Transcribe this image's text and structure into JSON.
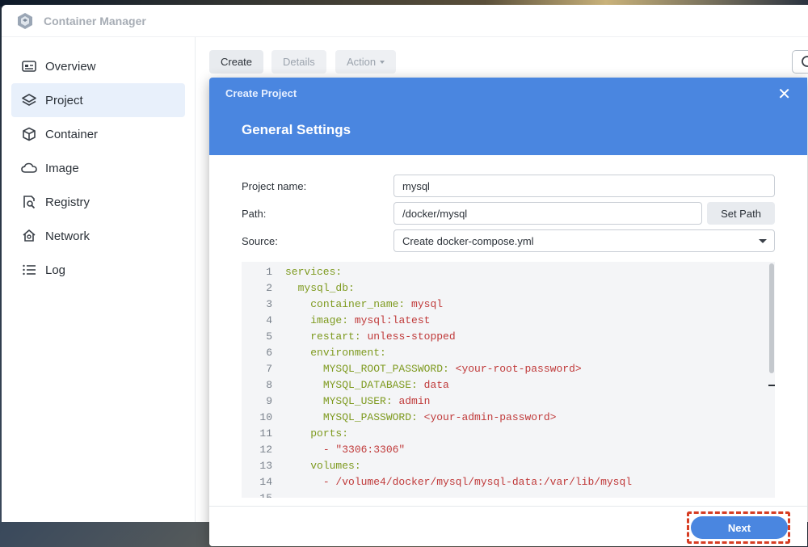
{
  "app": {
    "title": "Container Manager"
  },
  "sidebar": {
    "items": [
      {
        "label": "Overview",
        "icon": "overview-icon"
      },
      {
        "label": "Project",
        "icon": "layers-icon",
        "active": true
      },
      {
        "label": "Container",
        "icon": "cube-icon"
      },
      {
        "label": "Image",
        "icon": "cloud-icon"
      },
      {
        "label": "Registry",
        "icon": "registry-search-icon"
      },
      {
        "label": "Network",
        "icon": "network-house-icon"
      },
      {
        "label": "Log",
        "icon": "list-icon"
      }
    ]
  },
  "toolbar": {
    "create_label": "Create",
    "details_label": "Details",
    "action_label": "Action"
  },
  "modal": {
    "title": "Create Project",
    "heading": "General Settings",
    "close_glyph": "✕",
    "fields": {
      "project_name_label": "Project name:",
      "project_name_value": "mysql",
      "path_label": "Path:",
      "path_value": "/docker/mysql",
      "set_path_label": "Set Path",
      "source_label": "Source:",
      "source_value": "Create docker-compose.yml"
    },
    "code": [
      {
        "n": "1",
        "indent": "",
        "key": "services:",
        "val": ""
      },
      {
        "n": "2",
        "indent": "  ",
        "key": "mysql_db:",
        "val": ""
      },
      {
        "n": "3",
        "indent": "    ",
        "key": "container_name:",
        "val": " mysql"
      },
      {
        "n": "4",
        "indent": "    ",
        "key": "image:",
        "val": " mysql:latest"
      },
      {
        "n": "5",
        "indent": "    ",
        "key": "restart:",
        "val": " unless-stopped"
      },
      {
        "n": "6",
        "indent": "    ",
        "key": "environment:",
        "val": ""
      },
      {
        "n": "7",
        "indent": "      ",
        "key": "MYSQL_ROOT_PASSWORD:",
        "val": " <your-root-password>"
      },
      {
        "n": "8",
        "indent": "      ",
        "key": "MYSQL_DATABASE:",
        "val": " data"
      },
      {
        "n": "9",
        "indent": "      ",
        "key": "MYSQL_USER:",
        "val": " admin"
      },
      {
        "n": "10",
        "indent": "      ",
        "key": "MYSQL_PASSWORD:",
        "val": " <your-admin-password>"
      },
      {
        "n": "11",
        "indent": "    ",
        "key": "ports:",
        "val": ""
      },
      {
        "n": "12",
        "indent": "      ",
        "key": "- ",
        "val": "\"3306:3306\""
      },
      {
        "n": "13",
        "indent": "    ",
        "key": "volumes:",
        "val": ""
      },
      {
        "n": "14",
        "indent": "      ",
        "key": "- ",
        "val": "/volume4/docker/mysql/mysql-data:/var/lib/mysql"
      },
      {
        "n": "15",
        "indent": "",
        "key": "",
        "val": ""
      }
    ],
    "next_label": "Next"
  },
  "colors": {
    "accent": "#4a86e0",
    "highlight": "#d63c22",
    "yaml_key": "#7e9a1f",
    "yaml_value": "#c03a3a"
  }
}
